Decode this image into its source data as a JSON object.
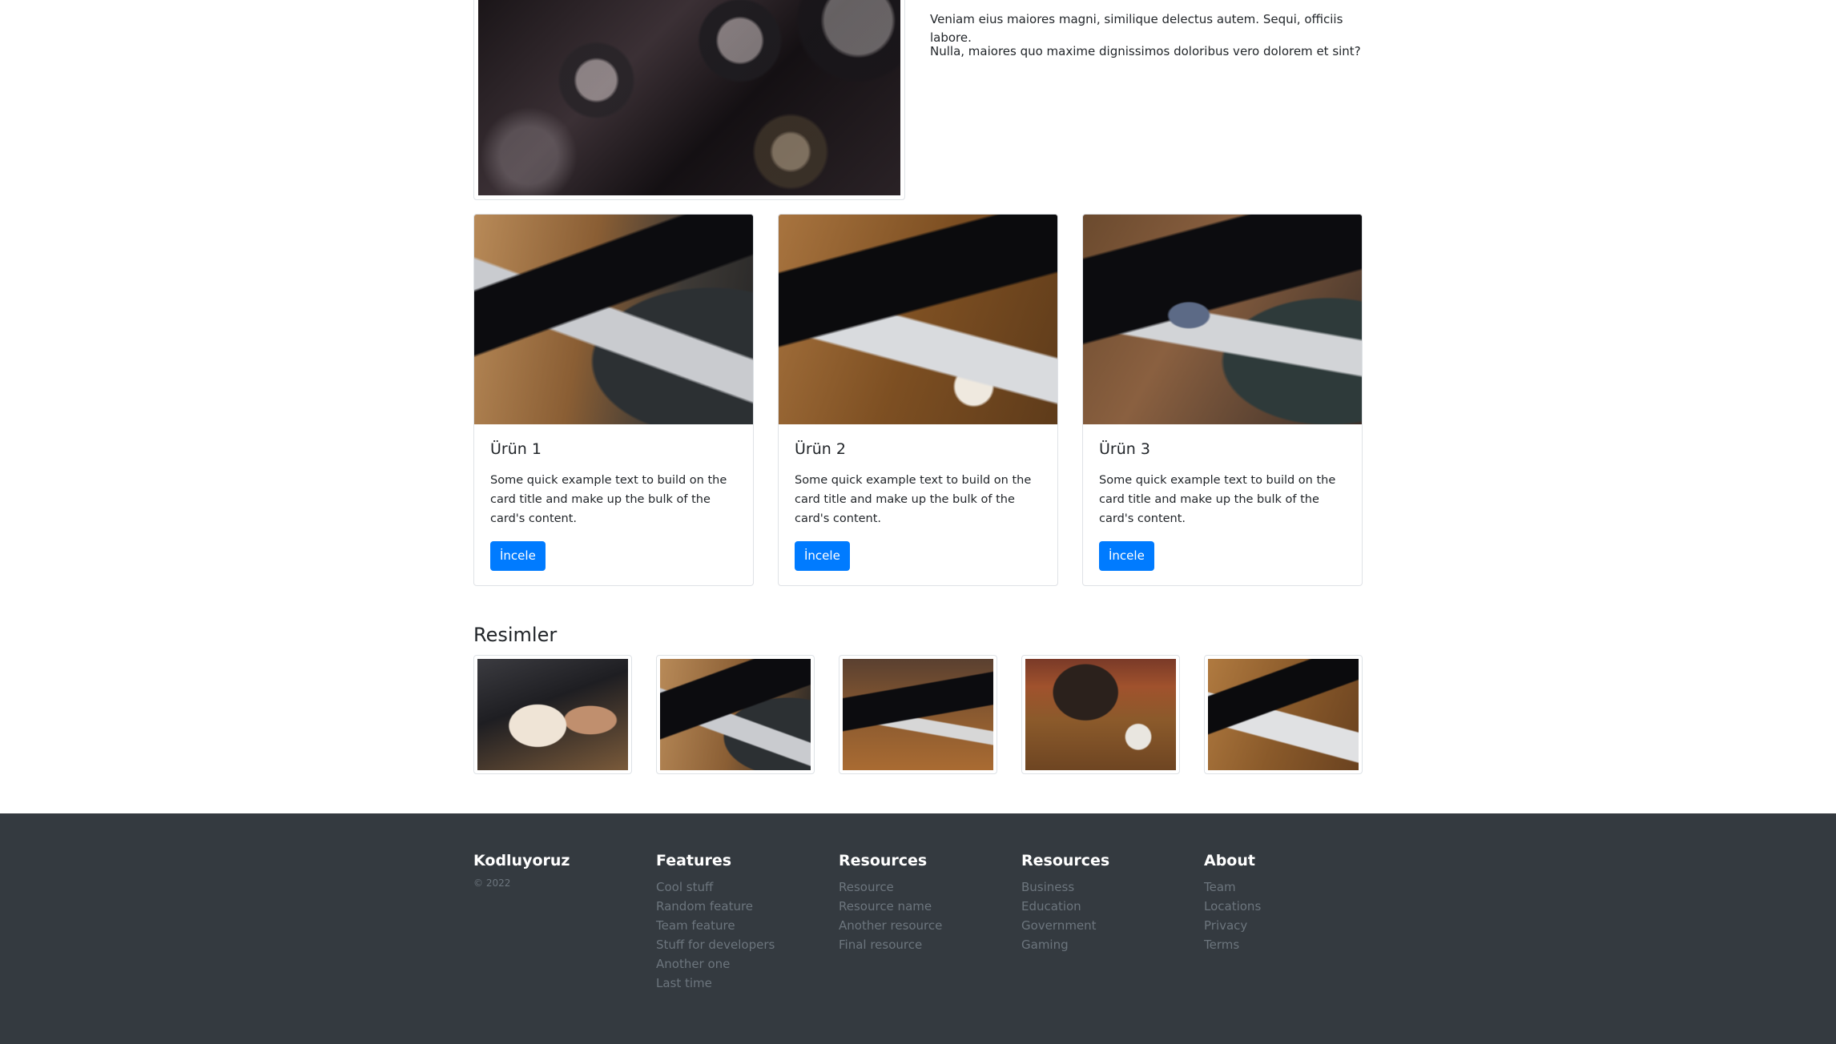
{
  "hero": {
    "paragraphs": [
      "Veniam eius maiores magni, similique delectus autem. Sequi, officiis labore.",
      "Nulla, maiores quo maxime dignissimos doloribus vero dolorem et sint?"
    ]
  },
  "cards": [
    {
      "title": "Ürün 1",
      "text": "Some quick example text to build on the card title and make up the bulk of the card's content.",
      "button": "İncele"
    },
    {
      "title": "Ürün 2",
      "text": "Some quick example text to build on the card title and make up the bulk of the card's content.",
      "button": "İncele"
    },
    {
      "title": "Ürün 3",
      "text": "Some quick example text to build on the card title and make up the bulk of the card's content.",
      "button": "İncele"
    }
  ],
  "gallery": {
    "heading": "Resimler"
  },
  "footer": {
    "brand": "Kodluyoruz",
    "copyright": "© 2022",
    "columns": [
      {
        "title": "Features",
        "links": [
          "Cool stuff",
          "Random feature",
          "Team feature",
          "Stuff for developers",
          "Another one",
          "Last time"
        ]
      },
      {
        "title": "Resources",
        "links": [
          "Resource",
          "Resource name",
          "Another resource",
          "Final resource"
        ]
      },
      {
        "title": "Resources",
        "links": [
          "Business",
          "Education",
          "Government",
          "Gaming"
        ]
      },
      {
        "title": "About",
        "links": [
          "Team",
          "Locations",
          "Privacy",
          "Terms"
        ]
      }
    ]
  },
  "colors": {
    "primary": "#007bff",
    "footer_bg": "#343a40",
    "muted": "#6c757d"
  }
}
